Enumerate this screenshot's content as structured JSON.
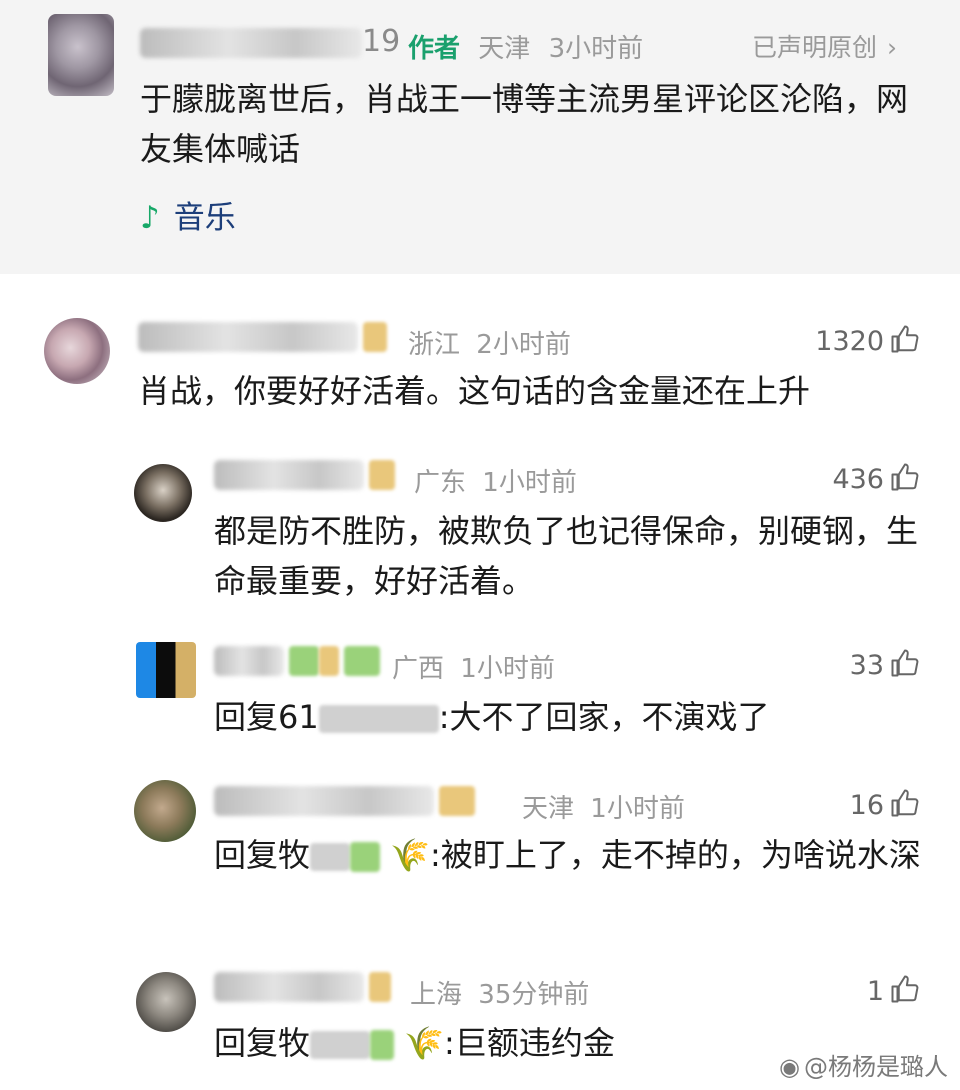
{
  "post": {
    "author_suffix": "19",
    "author_badge": "作者",
    "location": "天津",
    "time": "3小时前",
    "declared": "已声明原创",
    "declared_chevron": "›",
    "title": "于朦胧离世后，肖战王一博等主流男星评论区沦陷，网友集体喊话",
    "music_icon": "music-note-icon",
    "music_label": "音乐"
  },
  "comments": [
    {
      "location": "浙江",
      "time": "2小时前",
      "likes": "1320",
      "text": "肖战，你要好好活着。这句话的含金量还在上升"
    },
    {
      "location": "广东",
      "time": "1小时前",
      "likes": "436",
      "text": "都是防不胜防，被欺负了也记得保命，别硬钢，生命最重要，好好活着。"
    },
    {
      "location": "广西",
      "time": "1小时前",
      "likes": "33",
      "text_prefix": "回复61",
      "text": ":大不了回家，不演戏了"
    },
    {
      "location": "天津",
      "time": "1小时前",
      "likes": "16",
      "text_prefix": "回复牧",
      "text": ":被盯上了，走不掉的，为啥说水深"
    },
    {
      "location": "上海",
      "time": "35分钟前",
      "likes": "1",
      "text_prefix": "回复牧",
      "text": ":巨额违约金"
    }
  ],
  "watermark": "@杨杨是璐人",
  "colors": {
    "accent_green": "#1aa06d",
    "music_blue": "#1c3e7a",
    "post_bg": "#f4f4f4"
  }
}
